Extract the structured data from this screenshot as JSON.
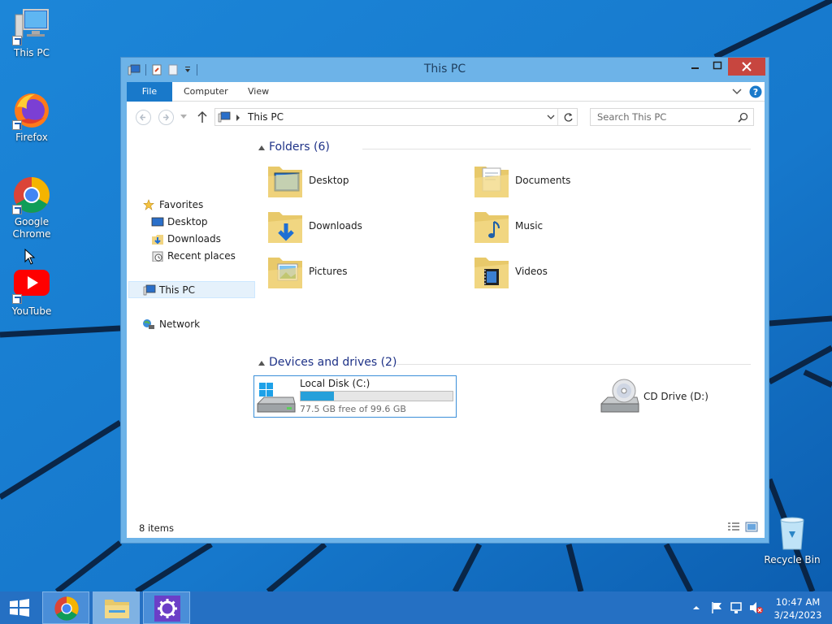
{
  "desktop": {
    "icons": [
      {
        "label": "This PC",
        "icon": "computer-icon"
      },
      {
        "label": "Firefox",
        "icon": "firefox-icon"
      },
      {
        "label": "Google Chrome",
        "icon": "chrome-icon"
      },
      {
        "label": "YouTube",
        "icon": "youtube-icon"
      },
      {
        "label": "Recycle Bin",
        "icon": "recycle-bin-icon"
      }
    ]
  },
  "window": {
    "title": "This PC",
    "ribbon_tabs": {
      "file": "File",
      "computer": "Computer",
      "view": "View"
    },
    "address": {
      "path": "This PC"
    },
    "search": {
      "placeholder": "Search This PC"
    },
    "nav_pane": {
      "favorites": "Favorites",
      "desktop": "Desktop",
      "downloads": "Downloads",
      "recent": "Recent places",
      "this_pc": "This PC",
      "network": "Network"
    },
    "groups": {
      "folders": "Folders (6)",
      "devices": "Devices and drives (2)"
    },
    "folders": [
      {
        "label": "Desktop",
        "icon": "desktop-folder-icon"
      },
      {
        "label": "Documents",
        "icon": "documents-folder-icon"
      },
      {
        "label": "Downloads",
        "icon": "downloads-folder-icon"
      },
      {
        "label": "Music",
        "icon": "music-folder-icon"
      },
      {
        "label": "Pictures",
        "icon": "pictures-folder-icon"
      },
      {
        "label": "Videos",
        "icon": "videos-folder-icon"
      }
    ],
    "drives": {
      "local": {
        "name": "Local Disk (C:)",
        "free": "77.5 GB free of 99.6 GB",
        "used_fraction": 0.22
      },
      "cd": {
        "name": "CD Drive (D:)"
      }
    },
    "status": {
      "items": "8 items"
    }
  },
  "taskbar": {
    "apps": [
      "start-icon",
      "chrome-icon",
      "file-explorer-icon",
      "settings-icon"
    ],
    "clock": {
      "time": "10:47 AM",
      "date": "3/24/2023"
    }
  },
  "colors": {
    "desktop": "#1a72c4",
    "taskbar": "#2570c3",
    "accent": "#1979ca",
    "close": "#c7463f"
  }
}
